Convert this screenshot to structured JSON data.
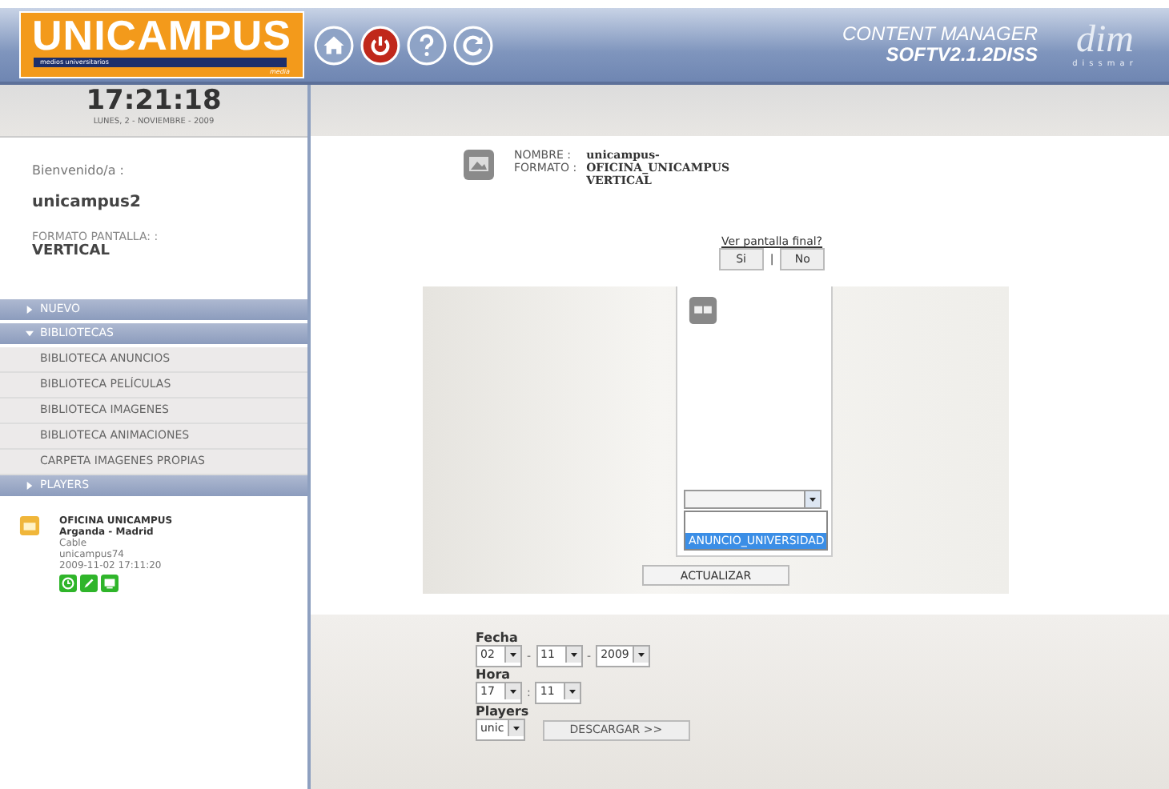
{
  "header": {
    "logo": "UNICAMPUS",
    "logo_tagline": "medios universitarios",
    "logo_sub": "media",
    "product": "CONTENT MANAGER",
    "version": "SOFTV2.1.2DISS",
    "brand": "dim",
    "brand_sub": "dissmar"
  },
  "clock": {
    "time": "17:21:18",
    "date": "LUNES, 2 - NOVIEMBRE - 2009"
  },
  "user": {
    "welcome": "Bienvenido/a :",
    "name": "unicampus2",
    "format_label": "FORMATO PANTALLA: :",
    "format": "VERTICAL"
  },
  "menu": [
    {
      "label": "NUEVO",
      "expanded": false
    },
    {
      "label": "BIBLIOTECAS",
      "expanded": true,
      "children": [
        "BIBLIOTECA ANUNCIOS",
        "BIBLIOTECA PELÍCULAS",
        "BIBLIOTECA IMAGENES",
        "BIBLIOTECA ANIMACIONES",
        "CARPETA IMAGENES PROPIAS"
      ]
    },
    {
      "label": "PLAYERS",
      "expanded": false
    }
  ],
  "player": {
    "name": "OFICINA UNICAMPUS",
    "location": "Arganda - Madrid",
    "connection": "Cable",
    "user": "unicampus74",
    "timestamp": "2009-11-02 17:11:20"
  },
  "info": {
    "name_label": "NOMBRE :",
    "format_label": "FORMATO :",
    "name": "unicampus-\nOFICINA_UNICAMPUS",
    "format": "VERTICAL"
  },
  "final_screen": {
    "question": "Ver pantalla final?",
    "yes": "Si",
    "separator": "|",
    "no": "No"
  },
  "slot_dropdown": {
    "options": [
      {
        "label": "ANUNCIO_UNIVERSIDAD",
        "selected": true
      }
    ]
  },
  "update_button": "ACTUALIZAR",
  "download": {
    "date_label": "Fecha",
    "day": "02",
    "month": "11",
    "year": "2009",
    "date_sep": "-",
    "hour_label": "Hora",
    "hour": "17",
    "minute": "11",
    "time_sep": ":",
    "players_label": "Players",
    "player": "unic",
    "button": "DESCARGAR >>"
  }
}
